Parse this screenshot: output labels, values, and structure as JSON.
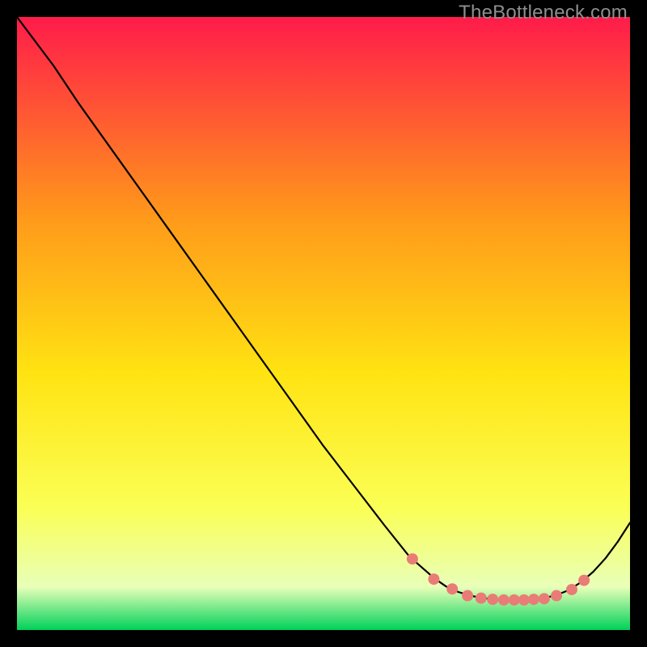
{
  "watermark": "TheBottleneck.com",
  "gradient": {
    "top": "#ff1b4a",
    "mid_upper": "#ff9a1a",
    "mid": "#ffe312",
    "mid_lower": "#fbff55",
    "low": "#e8ffb8",
    "bottom": "#00d15a"
  },
  "chart_data": {
    "type": "line",
    "title": "",
    "xlabel": "",
    "ylabel": "",
    "xlim": [
      0,
      100
    ],
    "ylim": [
      0,
      100
    ],
    "series": [
      {
        "name": "curve",
        "x": [
          0,
          6,
          10,
          15,
          20,
          25,
          30,
          35,
          40,
          45,
          50,
          55,
          60,
          64,
          68,
          70,
          72,
          74,
          76,
          78,
          80,
          82,
          84,
          86,
          88,
          90,
          92,
          94,
          96,
          98,
          100
        ],
        "y": [
          100,
          92,
          86,
          79,
          72,
          65,
          58,
          51,
          44,
          37,
          30,
          23.5,
          17,
          12,
          8.5,
          7.1,
          6.2,
          5.6,
          5.2,
          5.0,
          4.9,
          4.9,
          5.0,
          5.2,
          5.7,
          6.5,
          7.8,
          9.5,
          11.7,
          14.4,
          17.5
        ]
      }
    ],
    "markers": {
      "name": "dots",
      "x": [
        64.5,
        68,
        71,
        73.5,
        75.7,
        77.6,
        79.4,
        81.1,
        82.7,
        84.3,
        86,
        88,
        90.5,
        92.5
      ],
      "y": [
        11.6,
        8.3,
        6.7,
        5.6,
        5.2,
        5.0,
        4.9,
        4.9,
        4.9,
        5.0,
        5.1,
        5.6,
        6.6,
        8.1
      ],
      "color": "#e97c77",
      "radius": 7
    }
  }
}
